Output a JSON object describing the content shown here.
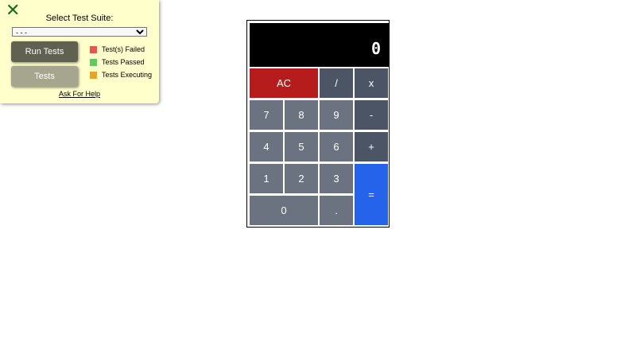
{
  "test_panel": {
    "close_glyph": "✕",
    "title": "Select Test Suite:",
    "suite_select_value": "- - -",
    "run_tests_label": "Run Tests",
    "tests_label": "Tests",
    "legend": [
      {
        "label": "Test(s) Failed",
        "color": "#e8564a"
      },
      {
        "label": "Tests Passed",
        "color": "#5ecb5e"
      },
      {
        "label": "Tests Executing",
        "color": "#f0a020"
      }
    ],
    "help_link": "Ask For Help"
  },
  "calculator": {
    "display": "0",
    "keys": {
      "ac": "AC",
      "divide": "/",
      "multiply": "x",
      "seven": "7",
      "eight": "8",
      "nine": "9",
      "minus": "-",
      "four": "4",
      "five": "5",
      "six": "6",
      "plus": "+",
      "one": "1",
      "two": "2",
      "three": "3",
      "equals": "=",
      "zero": "0",
      "decimal": "."
    }
  }
}
